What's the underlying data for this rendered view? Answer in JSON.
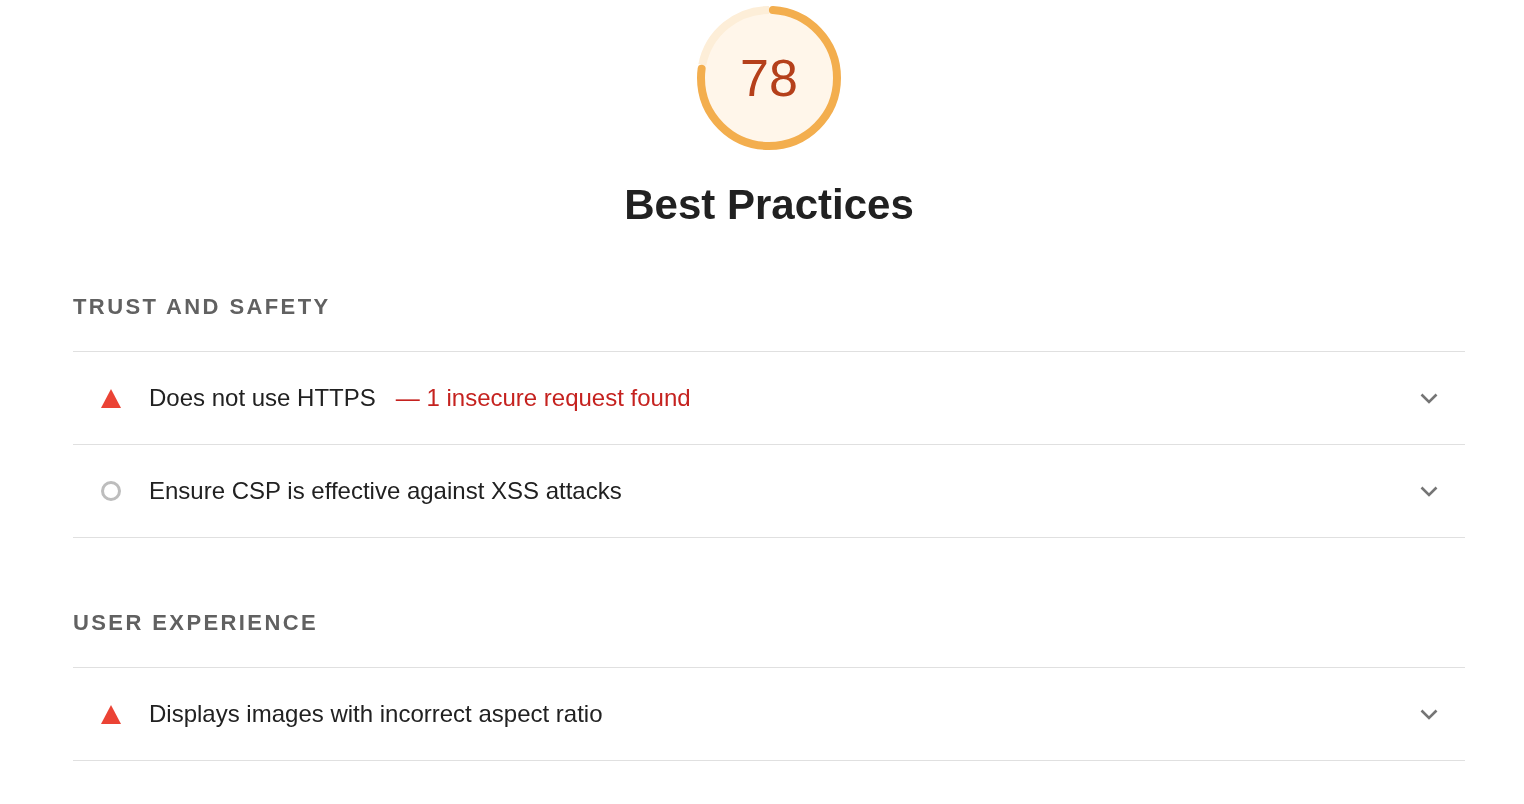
{
  "score": {
    "value": "78",
    "chart_data": [
      {
        "type": "donut",
        "values": [
          78,
          22
        ],
        "colors": [
          "#f3ae4e",
          "#fdeed8"
        ]
      }
    ]
  },
  "category_title": "Best Practices",
  "groups": [
    {
      "title": "TRUST AND SAFETY",
      "audits": [
        {
          "kind": "fail",
          "title": "Does not use HTTPS",
          "display_value": "— 1 insecure request found",
          "expanded": false
        },
        {
          "kind": "manual",
          "title": "Ensure CSP is effective against XSS attacks",
          "expanded": false
        }
      ]
    },
    {
      "title": "USER EXPERIENCE",
      "audits": [
        {
          "kind": "fail",
          "title": "Displays images with incorrect aspect ratio",
          "expanded": false
        }
      ]
    }
  ]
}
